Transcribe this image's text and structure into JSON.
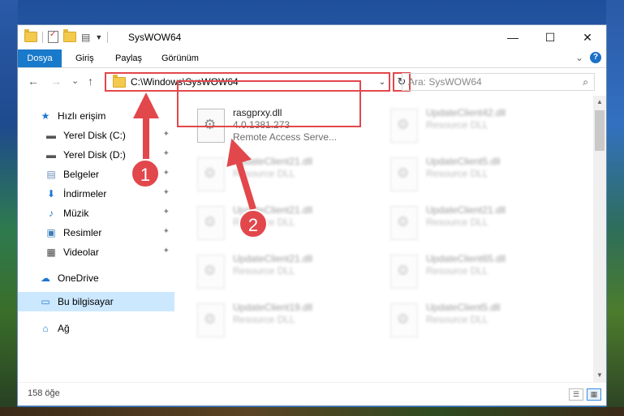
{
  "window": {
    "title": "SysWOW64",
    "controls": {
      "minimize": "—",
      "maximize": "☐",
      "close": "✕"
    }
  },
  "ribbon": {
    "tabs": [
      "Dosya",
      "Giriş",
      "Paylaş",
      "Görünüm"
    ],
    "collapse": "⌄",
    "help": "?"
  },
  "nav": {
    "back": "←",
    "forward": "→",
    "recent": "⌄",
    "up": "↑",
    "address": "C:\\Windows\\SysWOW64",
    "address_dropdown": "⌄",
    "refresh": "↻",
    "search_placeholder": "Ara: SysWOW64",
    "search_icon": "⌕"
  },
  "sidebar": {
    "items": [
      {
        "label": "Hızlı erişim",
        "icon": "star-icon",
        "pinned": false
      },
      {
        "label": "Yerel Disk (C:)",
        "icon": "drive-icon",
        "pinned": true
      },
      {
        "label": "Yerel Disk (D:)",
        "icon": "drive-icon",
        "pinned": true
      },
      {
        "label": "Belgeler",
        "icon": "document-icon",
        "pinned": true
      },
      {
        "label": "İndirmeler",
        "icon": "download-icon",
        "pinned": true
      },
      {
        "label": "Müzik",
        "icon": "music-icon",
        "pinned": true
      },
      {
        "label": "Resimler",
        "icon": "picture-icon",
        "pinned": true
      },
      {
        "label": "Videolar",
        "icon": "video-icon",
        "pinned": true
      },
      {
        "label": "OneDrive",
        "icon": "cloud-icon",
        "pinned": false
      },
      {
        "label": "Bu bilgisayar",
        "icon": "computer-icon",
        "pinned": false,
        "selected": true
      },
      {
        "label": "Ağ",
        "icon": "network-icon",
        "pinned": false
      }
    ],
    "pin_glyph": "📌"
  },
  "files": [
    {
      "name": "rasgprxy.dll",
      "line2": "4.0.1381.273",
      "line3": "Remote Access Serve...",
      "highlighted": true
    },
    {
      "name": "UpdateClient42.dll",
      "line2": "Resource DLL"
    },
    {
      "name": "UpdateClient21.dll",
      "line2": "Resource DLL"
    },
    {
      "name": "UpdateClient5.dll",
      "line2": "Resource DLL"
    },
    {
      "name": "UpdateClient21.dll",
      "line2": "Resource DLL"
    },
    {
      "name": "UpdateClient21.dll",
      "line2": "Resource DLL"
    },
    {
      "name": "UpdateClient21.dll",
      "line2": "Resource DLL"
    },
    {
      "name": "UpdateClient65.dll",
      "line2": "Resource DLL"
    },
    {
      "name": "UpdateClient19.dll",
      "line2": "Resource DLL"
    },
    {
      "name": "UpdateClient5.dll",
      "line2": "Resource DLL"
    }
  ],
  "status": {
    "count": "158 öğe"
  },
  "annotations": {
    "step1": "1",
    "step2": "2",
    "color": "#e2474c"
  }
}
